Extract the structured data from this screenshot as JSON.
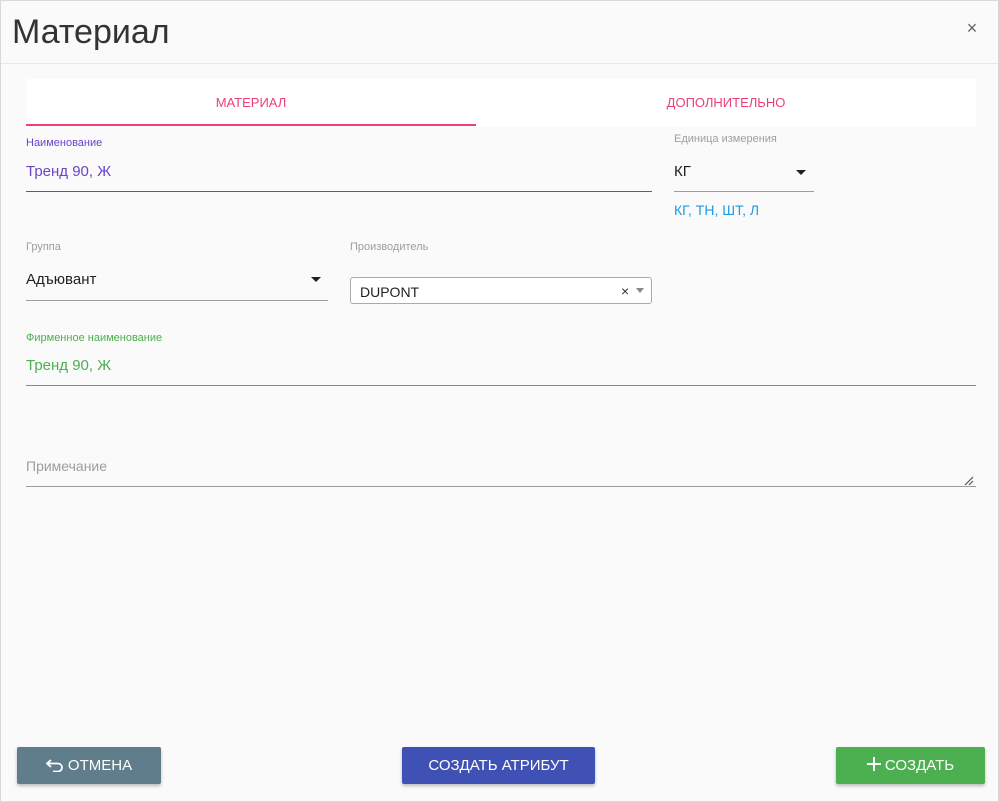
{
  "dialog": {
    "title": "Материал",
    "close_icon": "×"
  },
  "tabs": [
    {
      "label": "МАТЕРИАЛ",
      "active": true
    },
    {
      "label": "ДОПОЛНИТЕЛЬНО",
      "active": false
    }
  ],
  "fields": {
    "name": {
      "label": "Наименование",
      "value": "Тренд 90, Ж"
    },
    "unit": {
      "label": "Единица измерения",
      "value": "КГ",
      "options_hint": "КГ, ТН, ШТ, Л"
    },
    "group": {
      "label": "Группа",
      "value": "Адъювант"
    },
    "manufacturer": {
      "label": "Производитель",
      "value": "DUPONT",
      "clear_icon": "×"
    },
    "brand_name": {
      "label": "Фирменное наименование",
      "value": "Тренд 90, Ж"
    },
    "note": {
      "placeholder": "Примечание"
    }
  },
  "buttons": {
    "cancel": {
      "label": "ОТМЕНА",
      "icon": "undo-icon"
    },
    "create_attribute": {
      "label": "СОЗДАТЬ АТРИБУТ"
    },
    "create": {
      "label": "СОЗДАТЬ",
      "icon": "plus-icon"
    }
  },
  "colors": {
    "accent_pink": "#ec407a",
    "focus_purple": "#6a45c8",
    "valid_green": "#4caf50",
    "link_blue": "#1e9be0",
    "cancel_grey": "#607d8b",
    "primary_indigo": "#3f51b5"
  }
}
